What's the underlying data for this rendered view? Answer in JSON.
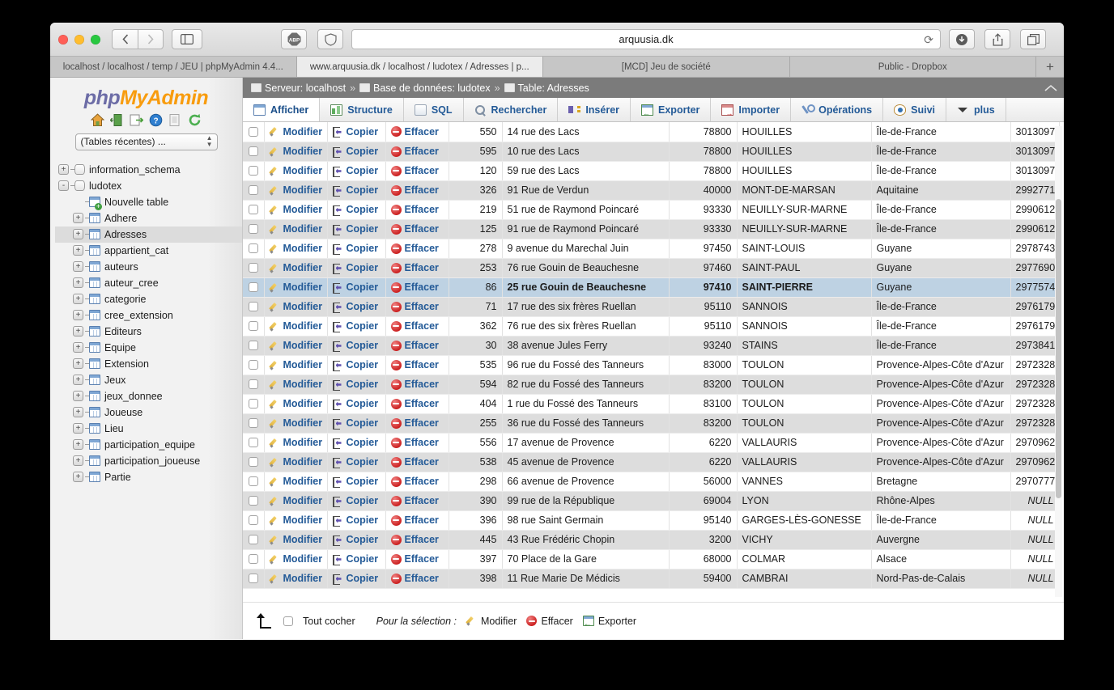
{
  "browser": {
    "url": "arquusia.dk",
    "reload_icon": "reload-icon",
    "back_icon": "chevron-left-icon",
    "forward_icon": "chevron-right-icon",
    "sidebar_icon": "sidebar-toggle-icon",
    "abp_label": "ABP",
    "shield_icon": "shield-icon",
    "download_icon": "download-icon",
    "share_icon": "share-icon",
    "tabs_icon": "show-all-tabs-icon",
    "new_tab_label": "+",
    "tabs": [
      {
        "title": "localhost / localhost / temp / JEU | phpMyAdmin 4.4...",
        "active": false
      },
      {
        "title": "www.arquusia.dk / localhost / ludotex / Adresses | p...",
        "active": true
      },
      {
        "title": "[MCD] Jeu de société",
        "active": false
      },
      {
        "title": "Public - Dropbox",
        "active": false
      }
    ]
  },
  "sidebar": {
    "logo": {
      "php": "php",
      "my": "My",
      "admin": "Admin"
    },
    "icons": [
      {
        "name": "home-icon"
      },
      {
        "name": "logout-icon"
      },
      {
        "name": "sql-query-icon"
      },
      {
        "name": "help-icon"
      },
      {
        "name": "documentation-icon"
      },
      {
        "name": "refresh-icon"
      }
    ],
    "recent_select": "(Tables récentes) ...",
    "tree": [
      {
        "label": "information_schema",
        "type": "db",
        "depth": 1,
        "expander": "+",
        "selected": false
      },
      {
        "label": "ludotex",
        "type": "db",
        "depth": 1,
        "expander": "-",
        "selected": false
      },
      {
        "label": "Nouvelle table",
        "type": "new",
        "depth": 2,
        "expander": "",
        "selected": false
      },
      {
        "label": "Adhere",
        "type": "table",
        "depth": 2,
        "expander": "+",
        "selected": false
      },
      {
        "label": "Adresses",
        "type": "table",
        "depth": 2,
        "expander": "+",
        "selected": true
      },
      {
        "label": "appartient_cat",
        "type": "table",
        "depth": 2,
        "expander": "+",
        "selected": false
      },
      {
        "label": "auteurs",
        "type": "table",
        "depth": 2,
        "expander": "+",
        "selected": false
      },
      {
        "label": "auteur_cree",
        "type": "table",
        "depth": 2,
        "expander": "+",
        "selected": false
      },
      {
        "label": "categorie",
        "type": "table",
        "depth": 2,
        "expander": "+",
        "selected": false
      },
      {
        "label": "cree_extension",
        "type": "table",
        "depth": 2,
        "expander": "+",
        "selected": false
      },
      {
        "label": "Editeurs",
        "type": "table",
        "depth": 2,
        "expander": "+",
        "selected": false
      },
      {
        "label": "Equipe",
        "type": "table",
        "depth": 2,
        "expander": "+",
        "selected": false
      },
      {
        "label": "Extension",
        "type": "table",
        "depth": 2,
        "expander": "+",
        "selected": false
      },
      {
        "label": "Jeux",
        "type": "table",
        "depth": 2,
        "expander": "+",
        "selected": false
      },
      {
        "label": "jeux_donnee",
        "type": "table",
        "depth": 2,
        "expander": "+",
        "selected": false
      },
      {
        "label": "Joueuse",
        "type": "table",
        "depth": 2,
        "expander": "+",
        "selected": false
      },
      {
        "label": "Lieu",
        "type": "table",
        "depth": 2,
        "expander": "+",
        "selected": false
      },
      {
        "label": "participation_equipe",
        "type": "table",
        "depth": 2,
        "expander": "+",
        "selected": false
      },
      {
        "label": "participation_joueuse",
        "type": "table",
        "depth": 2,
        "expander": "+",
        "selected": false
      },
      {
        "label": "Partie",
        "type": "table",
        "depth": 2,
        "expander": "+",
        "selected": false
      }
    ]
  },
  "breadcrumb": {
    "server_label": "Serveur: localhost",
    "database_label": "Base de données: ludotex",
    "table_label": "Table: Adresses",
    "separator": "»",
    "collapse_icon": "collapse-icon"
  },
  "nav_tabs": [
    {
      "label": "Afficher",
      "icon": "grid-icon",
      "active": true
    },
    {
      "label": "Structure",
      "icon": "structure-icon",
      "active": false
    },
    {
      "label": "SQL",
      "icon": "sql-icon",
      "active": false
    },
    {
      "label": "Rechercher",
      "icon": "search-icon",
      "active": false
    },
    {
      "label": "Insérer",
      "icon": "insert-icon",
      "active": false
    },
    {
      "label": "Exporter",
      "icon": "export-icon",
      "active": false
    },
    {
      "label": "Importer",
      "icon": "import-icon",
      "active": false
    },
    {
      "label": "Opérations",
      "icon": "wrench-icon",
      "active": false
    },
    {
      "label": "Suivi",
      "icon": "eye-icon",
      "active": false
    },
    {
      "label": "plus",
      "icon": "chevron-down-icon",
      "active": false
    }
  ],
  "row_actions": {
    "edit": "Modifier",
    "copy": "Copier",
    "delete": "Effacer"
  },
  "rows": [
    {
      "id": "550",
      "address": "14 rue des Lacs",
      "zip": "78800",
      "city": "HOUILLES",
      "region": "Île-de-France",
      "num": "3013097",
      "marked": false
    },
    {
      "id": "595",
      "address": "10 rue des Lacs",
      "zip": "78800",
      "city": "HOUILLES",
      "region": "Île-de-France",
      "num": "3013097",
      "marked": false
    },
    {
      "id": "120",
      "address": "59 rue des Lacs",
      "zip": "78800",
      "city": "HOUILLES",
      "region": "Île-de-France",
      "num": "3013097",
      "marked": false
    },
    {
      "id": "326",
      "address": "91 Rue de Verdun",
      "zip": "40000",
      "city": "MONT-DE-MARSAN",
      "region": "Aquitaine",
      "num": "2992771",
      "marked": false
    },
    {
      "id": "219",
      "address": "51 rue de Raymond Poincaré",
      "zip": "93330",
      "city": "NEUILLY-SUR-MARNE",
      "region": "Île-de-France",
      "num": "2990612",
      "marked": false
    },
    {
      "id": "125",
      "address": "91 rue de Raymond Poincaré",
      "zip": "93330",
      "city": "NEUILLY-SUR-MARNE",
      "region": "Île-de-France",
      "num": "2990612",
      "marked": false
    },
    {
      "id": "278",
      "address": "9 avenue du Marechal Juin",
      "zip": "97450",
      "city": "SAINT-LOUIS",
      "region": "Guyane",
      "num": "2978743",
      "marked": false
    },
    {
      "id": "253",
      "address": "76 rue Gouin de Beauchesne",
      "zip": "97460",
      "city": "SAINT-PAUL",
      "region": "Guyane",
      "num": "2977690",
      "marked": false
    },
    {
      "id": "86",
      "address": "25 rue Gouin de Beauchesne",
      "zip": "97410",
      "city": "SAINT-PIERRE",
      "region": "Guyane",
      "num": "2977574",
      "marked": true
    },
    {
      "id": "71",
      "address": "17 rue des six frères Ruellan",
      "zip": "95110",
      "city": "SANNOIS",
      "region": "Île-de-France",
      "num": "2976179",
      "marked": false
    },
    {
      "id": "362",
      "address": "76 rue des six frères Ruellan",
      "zip": "95110",
      "city": "SANNOIS",
      "region": "Île-de-France",
      "num": "2976179",
      "marked": false
    },
    {
      "id": "30",
      "address": "38 avenue Jules Ferry",
      "zip": "93240",
      "city": "STAINS",
      "region": "Île-de-France",
      "num": "2973841",
      "marked": false
    },
    {
      "id": "535",
      "address": "96 rue du Fossé des Tanneurs",
      "zip": "83000",
      "city": "TOULON",
      "region": "Provence-Alpes-Côte d'Azur",
      "num": "2972328",
      "marked": false
    },
    {
      "id": "594",
      "address": "82 rue du Fossé des Tanneurs",
      "zip": "83200",
      "city": "TOULON",
      "region": "Provence-Alpes-Côte d'Azur",
      "num": "2972328",
      "marked": false
    },
    {
      "id": "404",
      "address": "1 rue du Fossé des Tanneurs",
      "zip": "83100",
      "city": "TOULON",
      "region": "Provence-Alpes-Côte d'Azur",
      "num": "2972328",
      "marked": false
    },
    {
      "id": "255",
      "address": "36 rue du Fossé des Tanneurs",
      "zip": "83200",
      "city": "TOULON",
      "region": "Provence-Alpes-Côte d'Azur",
      "num": "2972328",
      "marked": false
    },
    {
      "id": "556",
      "address": "17 avenue de Provence",
      "zip": "6220",
      "city": "VALLAURIS",
      "region": "Provence-Alpes-Côte d'Azur",
      "num": "2970962",
      "marked": false
    },
    {
      "id": "538",
      "address": "45 avenue de Provence",
      "zip": "6220",
      "city": "VALLAURIS",
      "region": "Provence-Alpes-Côte d'Azur",
      "num": "2970962",
      "marked": false
    },
    {
      "id": "298",
      "address": "66 avenue de Provence",
      "zip": "56000",
      "city": "VANNES",
      "region": "Bretagne",
      "num": "2970777",
      "marked": false
    },
    {
      "id": "390",
      "address": "99 rue de la République",
      "zip": "69004",
      "city": "LYON",
      "region": "Rhône-Alpes",
      "num": "NULL",
      "marked": false
    },
    {
      "id": "396",
      "address": "98 rue Saint Germain",
      "zip": "95140",
      "city": "GARGES-LÈS-GONESSE",
      "region": "Île-de-France",
      "num": "NULL",
      "marked": false
    },
    {
      "id": "445",
      "address": "43 Rue Frédéric Chopin",
      "zip": "3200",
      "city": "VICHY",
      "region": "Auvergne",
      "num": "NULL",
      "marked": false
    },
    {
      "id": "397",
      "address": "70 Place de la Gare",
      "zip": "68000",
      "city": "COLMAR",
      "region": "Alsace",
      "num": "NULL",
      "marked": false
    },
    {
      "id": "398",
      "address": "11 Rue Marie De Médicis",
      "zip": "59400",
      "city": "CAMBRAI",
      "region": "Nord-Pas-de-Calais",
      "num": "NULL",
      "marked": false
    }
  ],
  "action_bar": {
    "up_arrow_icon": "arrow-up-icon",
    "check_all": "Tout cocher",
    "for_selection": "Pour la sélection :",
    "edit": "Modifier",
    "delete": "Effacer",
    "export": "Exporter"
  },
  "colors": {
    "link": "#235a97",
    "marked_row": "#bed2e3",
    "even_row": "#dddddd",
    "breadcrumb_bg": "#7b7b7b",
    "logo_orange": "#f89c0e",
    "logo_purple": "#6c6ca6"
  }
}
